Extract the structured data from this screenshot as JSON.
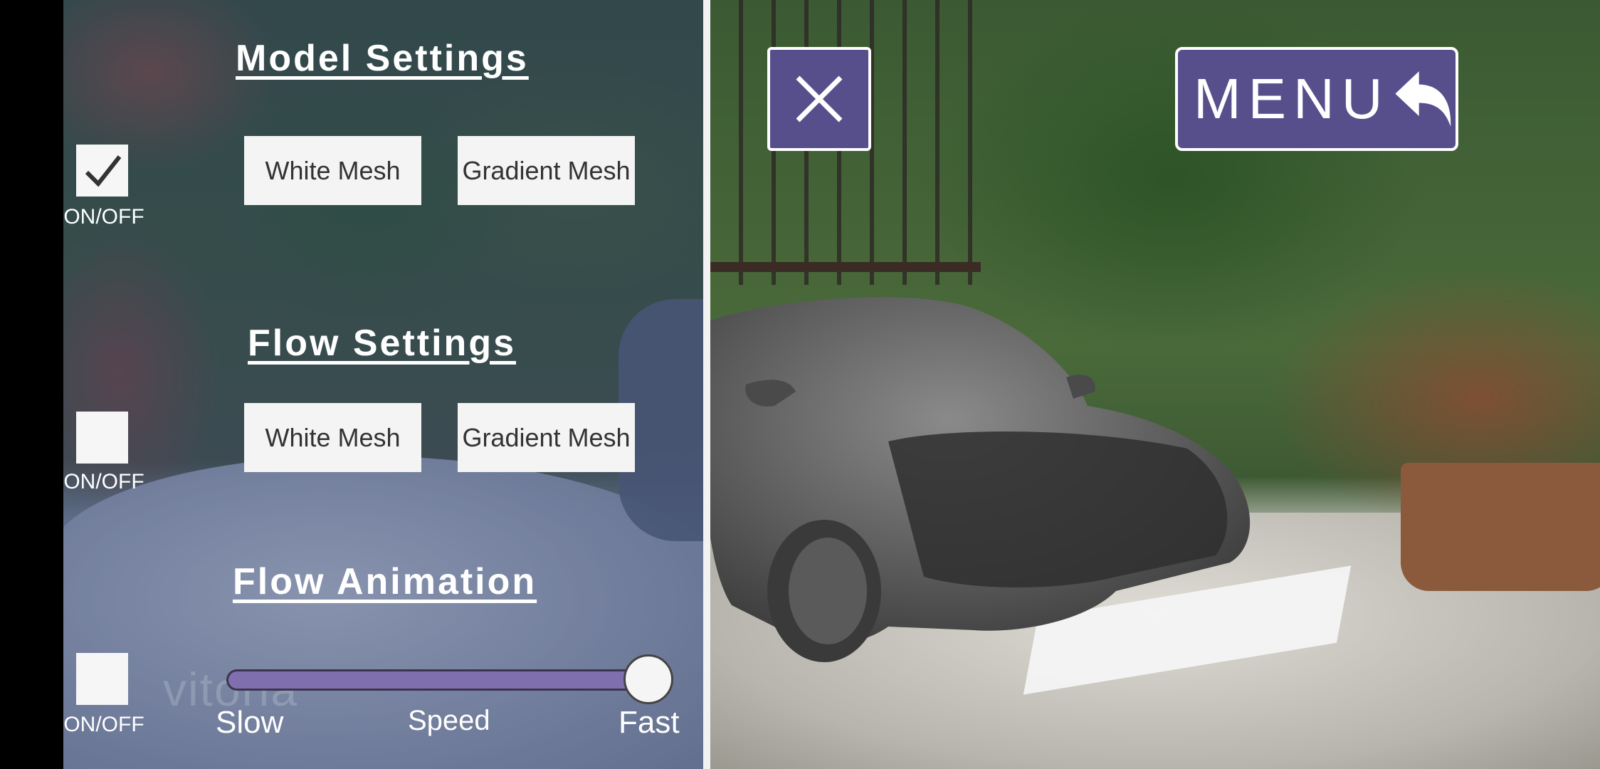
{
  "model_settings": {
    "title": "Model Settings",
    "toggle_label": "ON/OFF",
    "toggle_checked": true,
    "buttons": [
      "White Mesh",
      "Gradient Mesh"
    ]
  },
  "flow_settings": {
    "title": "Flow Settings",
    "toggle_label": "ON/OFF",
    "toggle_checked": false,
    "buttons": [
      "White Mesh",
      "Gradient Mesh"
    ]
  },
  "flow_animation": {
    "title": "Flow Animation",
    "toggle_label": "ON/OFF",
    "toggle_checked": false,
    "slider": {
      "min_label": "Slow",
      "mid_label": "Speed",
      "max_label": "Fast",
      "value_fraction": 1.0
    }
  },
  "background_logo": "vitoria",
  "top_bar": {
    "close_icon": "close-icon",
    "menu_label": "MENU",
    "menu_icon": "back-arrow-icon"
  },
  "colors": {
    "accent": "#574e8c",
    "slider_fill": "#7f6fae"
  }
}
